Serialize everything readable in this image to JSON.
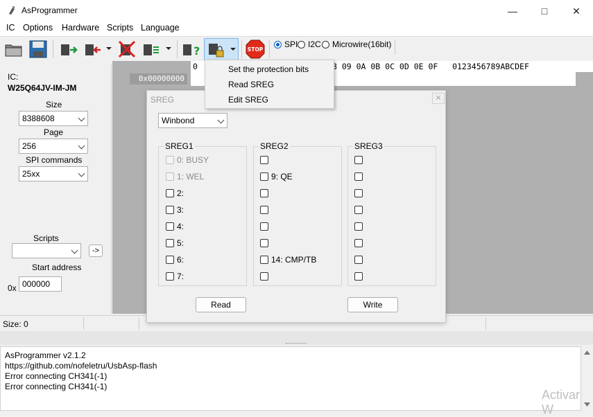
{
  "window": {
    "title": "AsProgrammer"
  },
  "menu": [
    "IC",
    "Options",
    "Hardware",
    "Scripts",
    "Language"
  ],
  "toolbar": {
    "radio_spi": "SPI",
    "radio_i2c": "I2C",
    "radio_microwire": "Microwire(16bit)",
    "selected_interface": "SPI"
  },
  "left": {
    "ic_label": "IC:",
    "ic_name": "W25Q64JV-IM-JM",
    "size_label": "Size",
    "size_value": "8388608",
    "page_label": "Page",
    "page_value": "256",
    "spi_label": "SPI commands",
    "spi_value": "25xx",
    "scripts_label": "Scripts",
    "scripts_value": "",
    "run_label": "->",
    "start_label": "Start address",
    "start_prefix": "0x",
    "start_value": "000000"
  },
  "hex": {
    "header_prefix": "0",
    "header_tail": "8 09 0A 0B 0C 0D 0E 0F   0123456789ABCDEF",
    "first_address": "0x00000000"
  },
  "dropdown": [
    "Set the protection bits",
    "Read SREG",
    "Edit SREG"
  ],
  "sreg": {
    "title": "SREG",
    "vendor": "Winbond",
    "groups": [
      {
        "title": "SREG1",
        "items": [
          "0: BUSY",
          "1: WEL",
          "2:",
          "3:",
          "4:",
          "5:",
          "6:",
          "7:"
        ]
      },
      {
        "title": "SREG2",
        "items": [
          "",
          "9: QE",
          "",
          "",
          "",
          "",
          "14: CMP/TB",
          ""
        ]
      },
      {
        "title": "SREG3",
        "items": [
          "",
          "",
          "",
          "",
          "",
          "",
          "",
          ""
        ]
      }
    ],
    "read_label": "Read",
    "write_label": "Write"
  },
  "status": {
    "size": "Size: 0"
  },
  "log": [
    "AsProgrammer v2.1.2",
    "https://github.com/nofeletru/UsbAsp-flash",
    "Error connecting CH341(-1)",
    "Error connecting CH341(-1)"
  ],
  "watermark": "Activar W"
}
